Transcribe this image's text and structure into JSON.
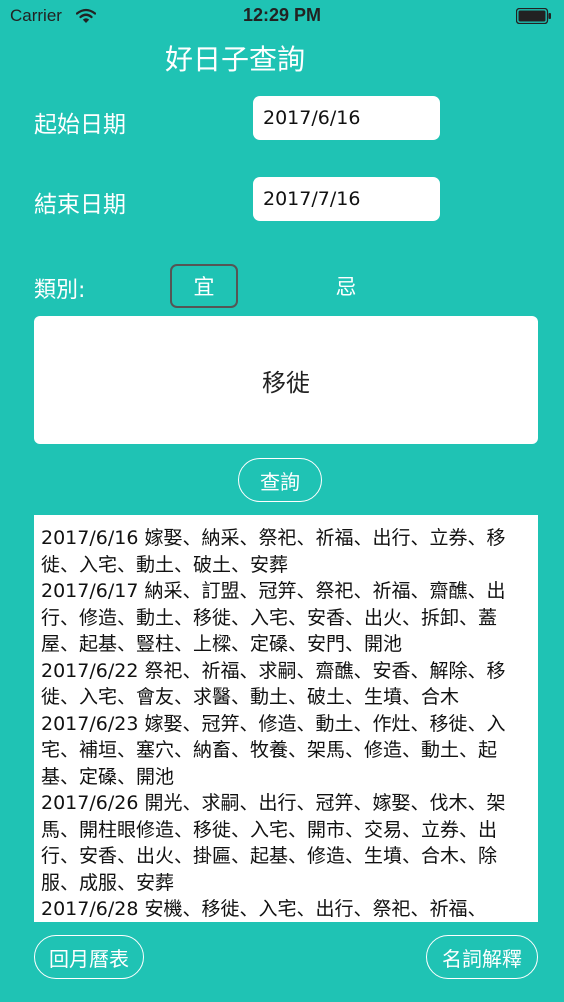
{
  "status_bar": {
    "carrier": "Carrier",
    "time": "12:29 PM"
  },
  "page": {
    "title": "好日子查詢"
  },
  "form": {
    "start_label": "起始日期",
    "start_value": "2017/6/16",
    "end_label": "結束日期",
    "end_value": "2017/7/16",
    "category_label": "類別:",
    "tabs": [
      {
        "label": "宜",
        "selected": true
      },
      {
        "label": "忌",
        "selected": false
      }
    ],
    "selected_activity": "移徙",
    "query_button": "查詢"
  },
  "results": [
    {
      "date": "2017/6/16",
      "items": "嫁娶、納采、祭祀、祈福、出行、立券、移徙、入宅、動土、破土、安葬"
    },
    {
      "date": "2017/6/17",
      "items": "納采、訂盟、冠笄、祭祀、祈福、齋醮、出行、修造、動土、移徙、入宅、安香、出火、拆卸、蓋屋、起基、豎柱、上樑、定磉、安門、開池"
    },
    {
      "date": "2017/6/22",
      "items": "祭祀、祈福、求嗣、齋醮、安香、解除、移徙、入宅、會友、求醫、動土、破土、生墳、合木"
    },
    {
      "date": "2017/6/23",
      "items": "嫁娶、冠笄、修造、動土、作灶、移徙、入宅、補垣、塞穴、納畜、牧養、架馬、修造、動土、起基、定磉、開池"
    },
    {
      "date": "2017/6/26",
      "items": "開光、求嗣、出行、冠笄、嫁娶、伐木、架馬、開柱眼修造、移徙、入宅、開市、交易、立券、出行、安香、出火、掛匾、起基、修造、生墳、合木、除服、成服、安葬"
    },
    {
      "date": "2017/6/28",
      "items": "安機、移徙、入宅、出行、祭祀、祈福、"
    }
  ],
  "footer": {
    "back_button": "回月曆表",
    "glossary_button": "名詞解釋"
  }
}
